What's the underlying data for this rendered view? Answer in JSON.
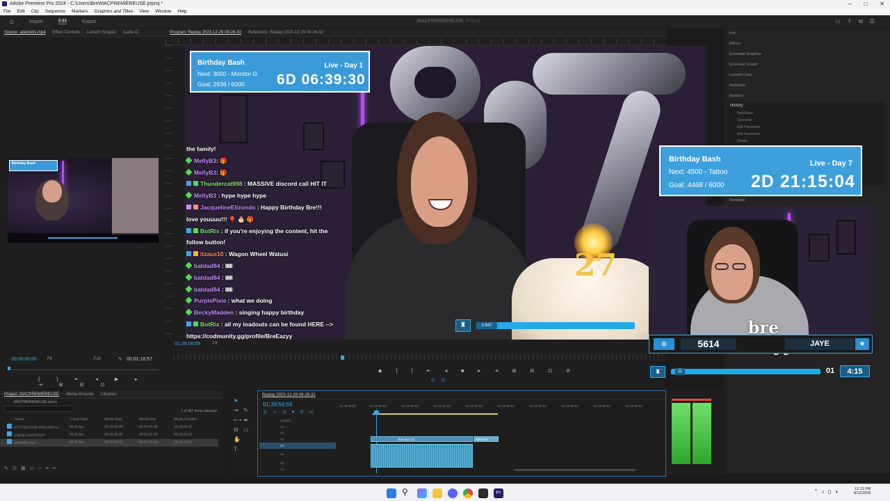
{
  "window": {
    "title": "Adobe Premiere Pro 2024 - C:\\Users\\Bre\\MACPREMIEREUSE.prproj *",
    "controls": [
      "–",
      "□",
      "✕"
    ]
  },
  "menu": [
    "File",
    "Edit",
    "Clip",
    "Sequence",
    "Markers",
    "Graphics and Titles",
    "View",
    "Window",
    "Help"
  ],
  "workspace": {
    "tabs": [
      "Import",
      "Edit",
      "Export"
    ],
    "active": "Edit",
    "project_name": "MACPREMIEREUSE",
    "project_suffix": "Edited"
  },
  "source_panel": {
    "tabs": [
      "Source: ademidis.mp4",
      "Effect Controls",
      "Lumetri Scopes",
      "Audio Cl"
    ],
    "timecode": "00:00:00:00",
    "fit": "Fit",
    "quality": "Full",
    "duration": "00:01:16:57"
  },
  "program_panel": {
    "tabs": [
      "Program: Replay 2023-12-29 09-26-32",
      "Reference: Replay 2023-12-29 09-26-32"
    ],
    "timecode": "01:39:56:59",
    "fit": "Fit"
  },
  "stream": {
    "widget_main": {
      "title": "Birthday Bash",
      "status": "Live - Day 1",
      "next": "Next: 3000 - Monitor G",
      "goal": "Goal: 2936 / 6000",
      "timer": "6D 06:39:30"
    },
    "chat": [
      {
        "user": "",
        "text": "the family!",
        "color": "u-w"
      },
      {
        "user": "MellyB3",
        "text": ": 🎁",
        "color": "u-p"
      },
      {
        "user": "MellyB3",
        "text": ": 🎁",
        "color": "u-p"
      },
      {
        "user": "Thundercat998",
        "text": " : MASSIVE discord call HIT IT",
        "color": "u-g"
      },
      {
        "user": "MellyB3",
        "text": " : hype hype hype",
        "color": "u-p"
      },
      {
        "user": "JacquelineElizondo",
        "text": " : Happy Birthday Bre!!!",
        "color": "u-p"
      },
      {
        "user": "",
        "text": "love youuuu!!! 🎈 🎂 🎁",
        "color": "u-w"
      },
      {
        "user": "BotRix",
        "text": " : if you're enjoying the content, hit the",
        "color": "u-g"
      },
      {
        "user": "",
        "text": "follow button!",
        "color": "u-w"
      },
      {
        "user": "itzaus10",
        "text": " : Wagon Wheel Watusi",
        "color": "u-r"
      },
      {
        "user": "batdad84",
        "text": " : 🎟",
        "color": "u-p"
      },
      {
        "user": "batdad84",
        "text": " : 🎟",
        "color": "u-p"
      },
      {
        "user": "batdad84",
        "text": " : 🎟",
        "color": "u-p"
      },
      {
        "user": "PurplePixie",
        "text": " : what we doing",
        "color": "u-p"
      },
      {
        "user": "BeckyMadden",
        "text": " : singing happy birthday",
        "color": "u-p"
      },
      {
        "user": "BotRix",
        "text": " : all my loadouts can be found HERE -->",
        "color": "u-g"
      },
      {
        "user": "",
        "text": "https://codmunity.gg/profile/BreEazyy",
        "color": "u-w"
      }
    ],
    "seek_value": "2:547"
  },
  "overlay_right": {
    "widget": {
      "title": "Birthday Bash",
      "status": "Live - Day 7",
      "next": "Next: 4500 - Tattoo",
      "goal": "Goal: 4468 / 6000",
      "timer": "2D 21:15:04"
    },
    "stat_count": "5614",
    "logo": "bre eazyy",
    "name": "JAYE",
    "seek_value": "21",
    "right_count": "01",
    "right_time": "4:15"
  },
  "right_panel": {
    "items": [
      "Info",
      "Effects",
      "Essential Graphics",
      "Essential Sound",
      "Lumetri Color",
      "Metadata",
      "Markers"
    ],
    "history_label": "History",
    "history_items": [
      "New/Open",
      "Overwrite",
      "Edit Parameter",
      "Edit Parameter",
      "Delete"
    ],
    "template_label": "Template"
  },
  "project_panel": {
    "tabs": [
      "Project: MACPREMIEREUSE",
      "Media Browser",
      "Libraries"
    ],
    "project_file": "MACPREMIEREUSE.prproj",
    "count": "1 of 967 items selected",
    "columns": [
      "Name",
      "Frame Rate",
      "Media Start",
      "Media End",
      "Media Duration"
    ],
    "rows": [
      {
        "name": "47737453-529f-455b-8594-d",
        "fps": "60.00 fps",
        "start": "00:00:00:00",
        "end": "00:00:04:36",
        "dur": "00:00:04:37"
      },
      {
        "name": "[Clips]Lucas19.mp4",
        "fps": "60.00 fps",
        "start": "00:00:00:00",
        "end": "00:00:20:24",
        "dur": "00:00:20:25"
      },
      {
        "name": "ademidis.mp4",
        "fps": "60.00 fps",
        "start": "00:00:00:00",
        "end": "00:01:16:56",
        "dur": "00:01:16:57"
      }
    ]
  },
  "timeline": {
    "sequence": "Replay 2023-12-29 09-26-32",
    "timecode": "01:39:56:59",
    "ruler": [
      "01:39:50:00",
      "01:40:00:00",
      "01:40:30:00",
      "01:41:00:00",
      "01:41:30:00",
      "01:42:00:00",
      "01:42:30:00",
      "01:43:00:00",
      "01:43:30:00",
      "01:44:00:00"
    ],
    "tracks": [
      "V4",
      "V3",
      "V2",
      "V1",
      "A1",
      "A2",
      "A3"
    ],
    "subtitle_label": "Subtitle",
    "clip_label": "ckd.mp4 [V]",
    "clip_label2": "ademidis"
  },
  "taskbar": {
    "time": "12:13 PM",
    "date": "8/12/2025"
  },
  "colors": {
    "accent": "#3a9ad8",
    "chat_green": "#7ee36b",
    "chat_purple": "#c48cff",
    "meter_green": "#4ee04a"
  }
}
